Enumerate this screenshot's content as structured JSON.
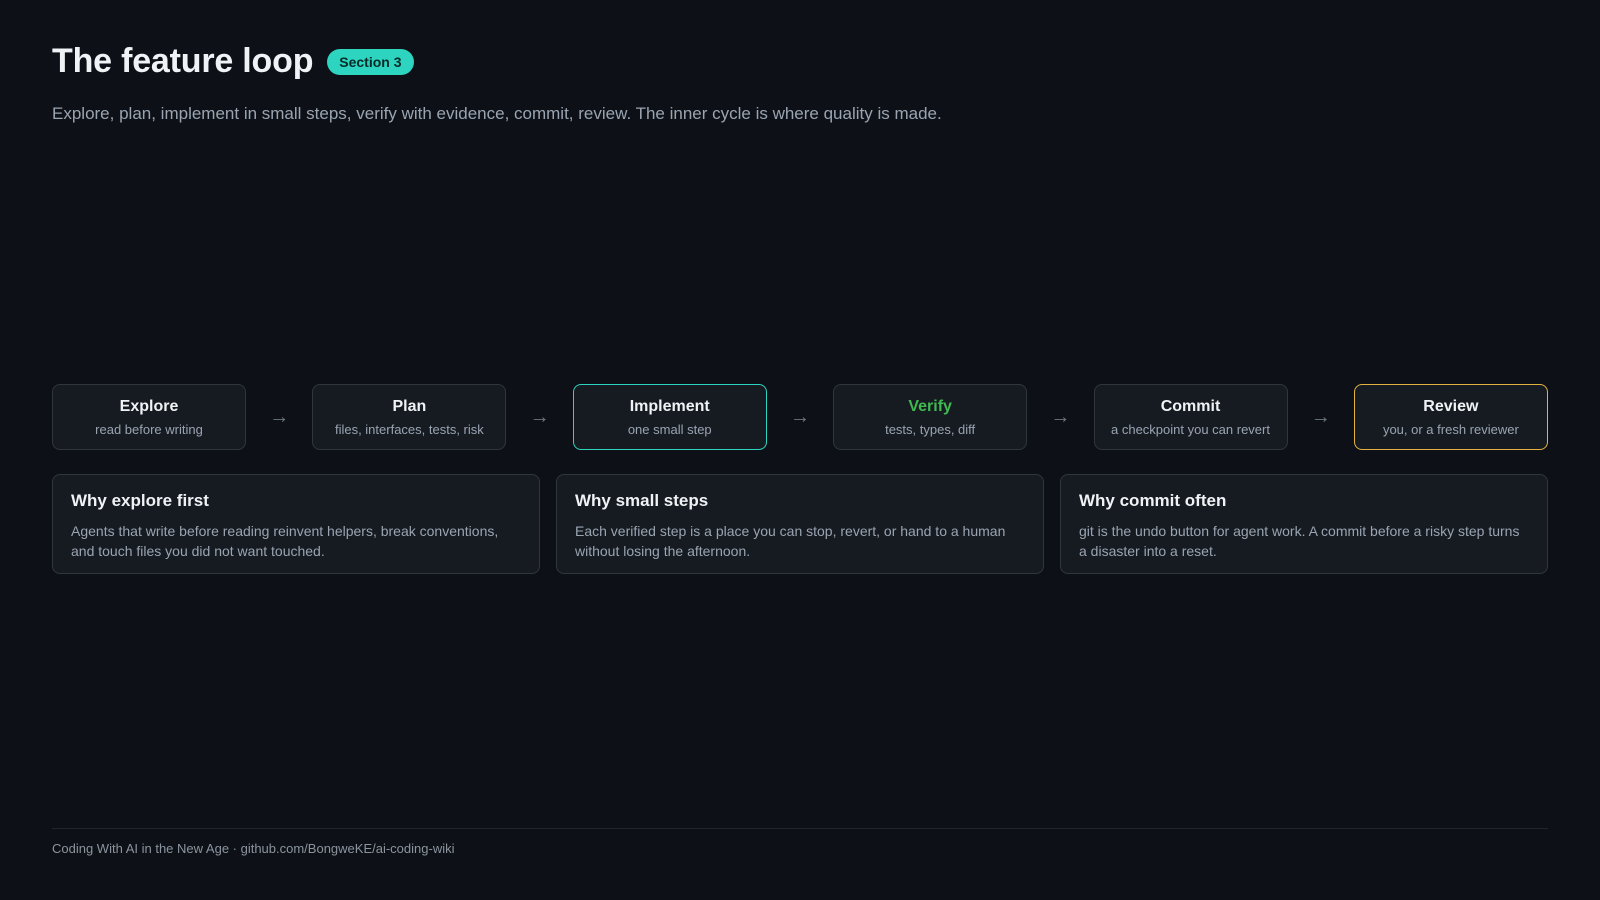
{
  "header": {
    "title": "The feature loop",
    "badge": "Section 3",
    "subtitle": "Explore, plan, implement in small steps, verify with evidence, commit, review. The inner cycle is where quality is made."
  },
  "flow": {
    "arrow": "→",
    "steps": [
      {
        "name": "Explore",
        "desc": "read before writing"
      },
      {
        "name": "Plan",
        "desc": "files, interfaces, tests, risk"
      },
      {
        "name": "Implement",
        "desc": "one small step"
      },
      {
        "name": "Verify",
        "desc": "tests, types, diff"
      },
      {
        "name": "Commit",
        "desc": "a checkpoint you can revert"
      },
      {
        "name": "Review",
        "desc": "you, or a fresh reviewer"
      }
    ]
  },
  "cards": [
    {
      "title": "Why explore first",
      "text": "Agents that write before reading reinvent helpers, break conventions, and touch files you did not want touched."
    },
    {
      "title": "Why small steps",
      "text": "Each verified step is a place you can stop, revert, or hand to a human without losing the afternoon."
    },
    {
      "title": "Why commit often",
      "text": "git is the undo button for agent work. A commit before a risky step turns a disaster into a reset."
    }
  ],
  "footer": {
    "text": "Coding With AI in the New Age · github.com/BongweKE/ai-coding-wiki"
  },
  "colors": {
    "background": "#0d1117",
    "accent_teal": "#2dd4bf",
    "verify_green": "#3fb950",
    "review_amber": "#e3b341"
  }
}
